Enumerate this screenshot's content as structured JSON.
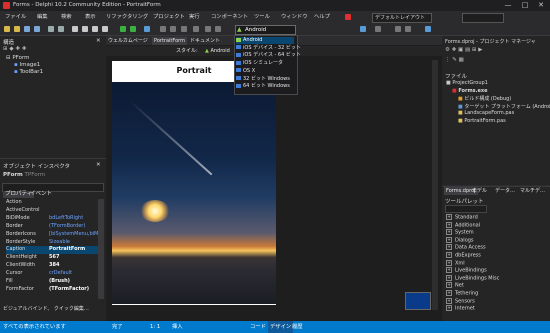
{
  "window": {
    "title": "Forms - Delphi 10.2 Community Edition - PortraitForm",
    "minimize": "—",
    "maximize": "□",
    "close": "✕"
  },
  "menu": [
    "ファイル",
    "編集",
    "検索",
    "表示",
    "リファクタリング",
    "プロジェクト",
    "実行",
    "コンポーネント",
    "ツール",
    "ウィンドウ",
    "ヘルプ"
  ],
  "layout_select": "デフォルトレイアウト",
  "platform_combo": "Android",
  "platform_dropdown": [
    "Android",
    "iOS デバイス - 32 ビット",
    "iOS デバイス - 64 ビット",
    "iOS シミュレータ",
    "OS X",
    "32 ビット Windows",
    "64 ビット Windows"
  ],
  "structure": {
    "title": "構造",
    "tree": [
      "PForm",
      "Image1",
      "ToolBar1"
    ]
  },
  "doc_tabs": [
    "ウェルカムページ",
    "PortraitForm",
    "ドキュメント"
  ],
  "design_toolbar": {
    "style_label": "スタイル:",
    "style_value": "Android"
  },
  "form": {
    "caption": "Portrait"
  },
  "inspector": {
    "title": "オブジェクト インスペクタ",
    "object_name": "PForm",
    "object_type": "TPForm",
    "tabs": [
      "プロパティ",
      "イベント"
    ],
    "properties": [
      {
        "name": "Action",
        "value": ""
      },
      {
        "name": "ActiveControl",
        "value": ""
      },
      {
        "name": "BiDiMode",
        "value": "bdLeftToRight"
      },
      {
        "name": "Border",
        "value": "(TFormBorder)"
      },
      {
        "name": "BorderIcons",
        "value": "[biSystemMenu,biMin"
      },
      {
        "name": "BorderStyle",
        "value": "Sizeable"
      },
      {
        "name": "Caption",
        "value": "PortraitForm"
      },
      {
        "name": "ClientHeight",
        "value": "567"
      },
      {
        "name": "ClientWidth",
        "value": "384"
      },
      {
        "name": "Cursor",
        "value": "crDefault"
      },
      {
        "name": "Fill",
        "value": "(Brush)"
      },
      {
        "name": "FormFactor",
        "value": "(TFormFactor)"
      }
    ],
    "footer": "ビジュアルバインド、 クイック編集…",
    "footer_status": "すべての表示されています"
  },
  "project": {
    "title": "Forms.dproj - プロジェクト マネージャ",
    "file_label": "ファイル",
    "tree": [
      "ProjectGroup1",
      "Forms.exe",
      "ビルド構成 (Debug)",
      "ターゲット プラットフォーム (Android)",
      "LandscapeForm.pas",
      "PortraitForm.pas"
    ]
  },
  "right_tabs": [
    "Forms.dproj",
    "モデル",
    "データ…",
    "マルチデ…"
  ],
  "palette": {
    "title": "ツールパレット",
    "categories": [
      "Standard",
      "Additional",
      "System",
      "Dialogs",
      "Data Access",
      "dbExpress",
      "Xml",
      "LiveBindings",
      "LiveBindings Misc",
      "Net",
      "Tethering",
      "Sensors",
      "Internet"
    ]
  },
  "status": {
    "left": "すべての表示されています",
    "mode": "完了",
    "pos": "1: 1",
    "insert": "挿入",
    "tabs": [
      "コード",
      "デザイン",
      "履歴"
    ]
  }
}
